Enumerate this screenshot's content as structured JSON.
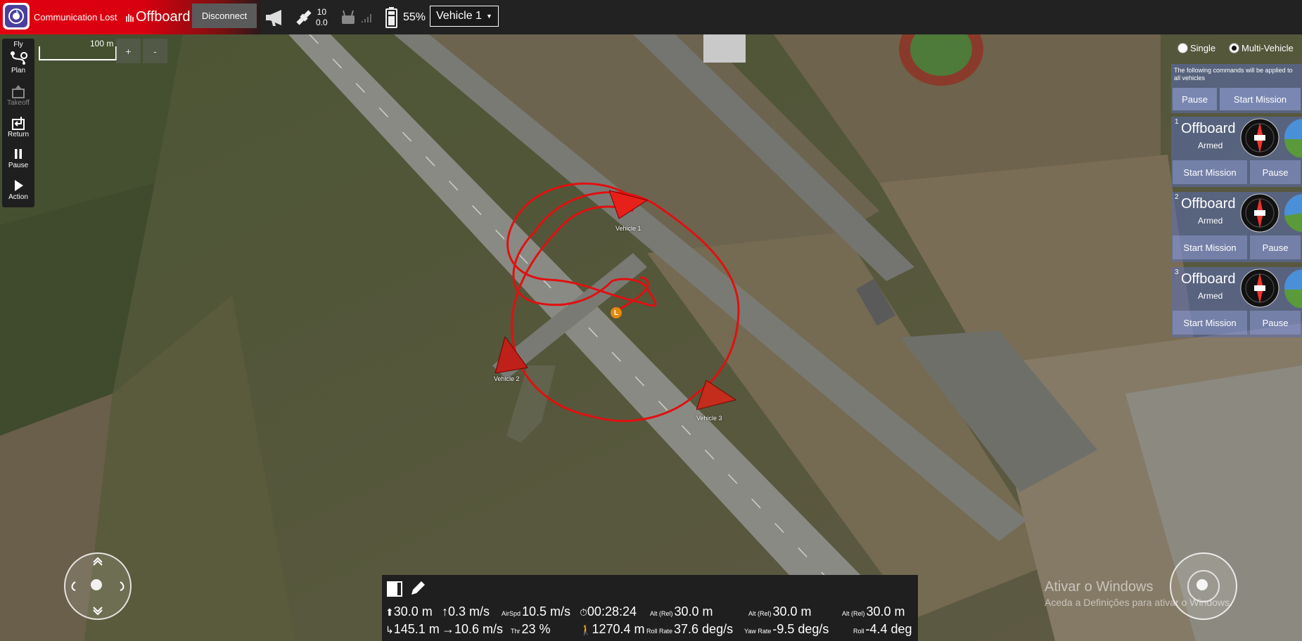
{
  "topbar": {
    "status": "Communication Lost",
    "flight_mode": "Offboard",
    "disconnect_label": "Disconnect",
    "satellite_count": "10",
    "hdop": "0.0",
    "battery": "55%",
    "vehicle_selector": "Vehicle 1"
  },
  "toolbar": {
    "fly": "Fly",
    "plan": "Plan",
    "takeoff": "Takeoff",
    "return": "Return",
    "pause": "Pause",
    "action": "Action"
  },
  "map": {
    "scale_label": "100 m",
    "zoom_in": "+",
    "zoom_out": "-",
    "home_marker": "L",
    "vehicle_labels": [
      "Vehicle 1",
      "Vehicle 2",
      "Vehicle 3"
    ],
    "trajectory_color": "#e01010"
  },
  "multivehicle": {
    "single_label": "Single",
    "multi_label": "Multi-Vehicle",
    "selected": "Multi-Vehicle",
    "info": "The following commands will be applied to all vehicles",
    "pause_all": "Pause",
    "start_all": "Start Mission",
    "vehicles": [
      {
        "id": "1",
        "mode": "Offboard",
        "state": "Armed",
        "start": "Start Mission",
        "pause": "Pause"
      },
      {
        "id": "2",
        "mode": "Offboard",
        "state": "Armed",
        "start": "Start Mission",
        "pause": "Pause"
      },
      {
        "id": "3",
        "mode": "Offboard",
        "state": "Armed",
        "start": "Start Mission",
        "pause": "Pause"
      }
    ]
  },
  "telemetry": {
    "alt": "30.0 m",
    "vspeed": "0.3 m/s",
    "airspd_label": "AirSpd",
    "airspd": "10.5 m/s",
    "flight_time": "00:28:24",
    "alt_rel_label": "Alt (Rel)",
    "alt_rel_1": "30.0 m",
    "alt_rel_2": "30.0 m",
    "alt_rel_3": "30.0 m",
    "dist": "145.1 m",
    "gspeed": "10.6 m/s",
    "thr_label": "Thr",
    "thr": "23 %",
    "dist_home": "1270.4 m",
    "roll_rate_label": "Roll Rate",
    "roll_rate": "37.6 deg/s",
    "yaw_rate_label": "Yaw Rate",
    "yaw_rate": "-9.5 deg/s",
    "roll_label": "Roll",
    "roll": "-4.4 deg"
  },
  "watermark": {
    "line1": "Ativar o Windows",
    "line2": "Aceda a Definições para ativar o Windows."
  }
}
